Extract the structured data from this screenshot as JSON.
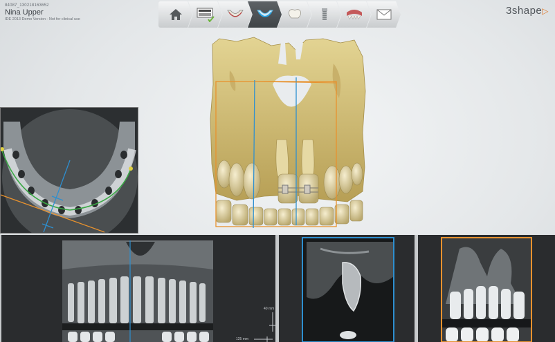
{
  "patient": {
    "id": "84087_130218163652",
    "name": "Nina Upper",
    "note": "IDE 2013 Demo Version - Not for clinical use"
  },
  "toolbar": {
    "steps": [
      {
        "name": "home",
        "icon": "home-icon",
        "active": false
      },
      {
        "name": "scan-info",
        "icon": "scan-info-icon",
        "active": false,
        "checked": true
      },
      {
        "name": "jaw-model",
        "icon": "jaw-icon",
        "active": false
      },
      {
        "name": "jaw-highlight",
        "icon": "jaw-highlight-icon",
        "active": true
      },
      {
        "name": "tooth",
        "icon": "tooth-icon",
        "active": false
      },
      {
        "name": "implant",
        "icon": "implant-icon",
        "active": false
      },
      {
        "name": "gum",
        "icon": "gum-icon",
        "active": false
      },
      {
        "name": "mail",
        "icon": "mail-icon",
        "active": false
      }
    ]
  },
  "brand": {
    "logo_text": "3shape"
  },
  "panels": {
    "axial": "axial-slice",
    "pano": "panoramic-view",
    "cross_blue": "cross-section-blue",
    "cross_orange": "cross-section-orange"
  },
  "scale": {
    "label_top": "40 mm",
    "label_bottom": "125 mm"
  },
  "colors": {
    "blue": "#2d8fd0",
    "orange": "#e8922e",
    "curve": "#3aa845",
    "bone": "#d9c98e"
  }
}
